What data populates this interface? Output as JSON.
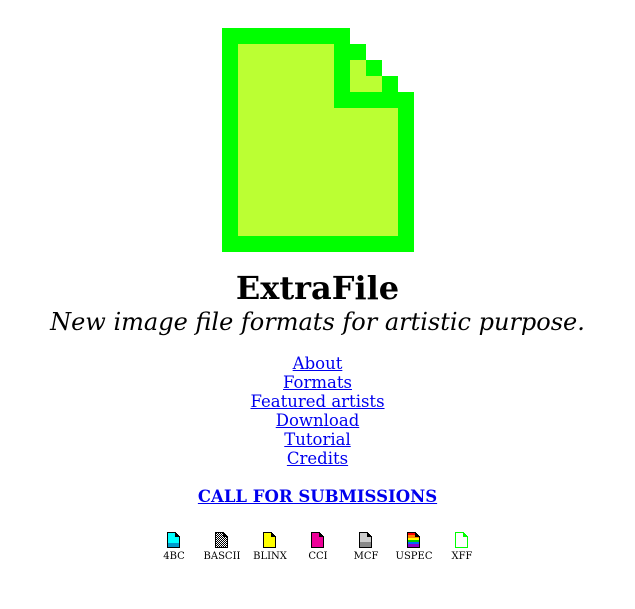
{
  "header": {
    "title": "ExtraFile",
    "subtitle": "New image file formats for artistic purpose."
  },
  "logo": {
    "icon": "file-icon",
    "outline_color": "#00ff00",
    "fill_color": "#bbff33"
  },
  "nav": {
    "items": [
      {
        "label": "About"
      },
      {
        "label": "Formats"
      },
      {
        "label": "Featured artists"
      },
      {
        "label": "Download"
      },
      {
        "label": "Tutorial"
      },
      {
        "label": "Credits"
      }
    ]
  },
  "call": {
    "label": "CALL FOR SUBMISSIONS"
  },
  "formats": [
    {
      "label": "4BC",
      "icon": "file-4bc-icon",
      "color": "#00ffff"
    },
    {
      "label": "BASCII",
      "icon": "file-bascii-icon",
      "color": "#888888"
    },
    {
      "label": "BLINX",
      "icon": "file-blinx-icon",
      "color": "#ffff00"
    },
    {
      "label": "CCI",
      "icon": "file-cci-icon",
      "color": "#ee0099"
    },
    {
      "label": "MCF",
      "icon": "file-mcf-icon",
      "color": "#cccccc"
    },
    {
      "label": "USPEC",
      "icon": "file-uspec-icon",
      "color": "#ff8800"
    },
    {
      "label": "XFF",
      "icon": "file-xff-icon",
      "color": "#00ff00"
    }
  ]
}
